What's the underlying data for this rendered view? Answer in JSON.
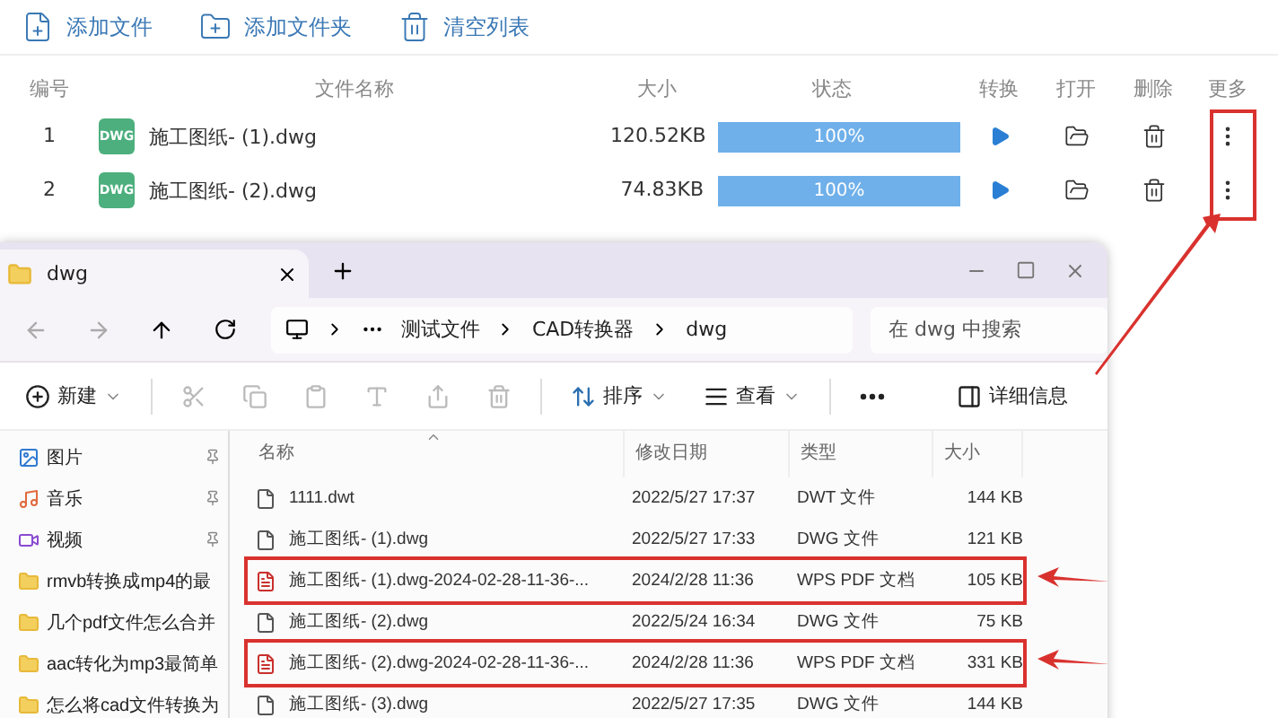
{
  "toolbar": [
    {
      "label": "添加文件",
      "kind": "file"
    },
    {
      "label": "添加文件夹",
      "kind": "folder"
    },
    {
      "label": "清空列表",
      "kind": "clear"
    }
  ],
  "table": {
    "columns": [
      "编号",
      "文件名称",
      "大小",
      "状态",
      "转换",
      "打开",
      "删除",
      "更多"
    ],
    "more_highlighted": true,
    "rows": [
      {
        "index": "1",
        "badge": "DWG",
        "name": "施工图纸- (1).dwg",
        "size": "120.52KB",
        "level": 1,
        "status": "100%"
      },
      {
        "index": "2",
        "badge": "DWG",
        "name": "施工图纸- (2).dwg",
        "size": "74.83KB",
        "level": 1,
        "status": "100%"
      }
    ]
  },
  "explorer": {
    "tab": {
      "title": "dwg"
    },
    "breadcrumb": [
      "测试文件",
      "CAD转换器",
      "dwg"
    ],
    "search": {
      "placeholder": "在 dwg 中搜索"
    },
    "commands": [
      {
        "label": "新建",
        "kind": "new"
      },
      {
        "label": "排序",
        "kind": "sort"
      },
      {
        "label": "查看",
        "kind": "view"
      }
    ],
    "details": "详细信息",
    "sidebar": [
      {
        "label": "图片",
        "kind": "pictures",
        "pinned": true
      },
      {
        "label": "音乐",
        "kind": "music",
        "pinned": true
      },
      {
        "label": "视频",
        "kind": "video",
        "pinned": true
      },
      {
        "label": "rmvb转换成mp4的最",
        "kind": "folder",
        "pinned": false
      },
      {
        "label": "几个pdf文件怎么合并",
        "kind": "folder",
        "pinned": false
      },
      {
        "label": "aac转化为mp3最简单",
        "kind": "folder",
        "pinned": false
      },
      {
        "label": "怎么将cad文件转换为",
        "kind": "folder",
        "pinned": false
      }
    ],
    "columns": [
      "名称",
      "修改日期",
      "类型",
      "大小"
    ],
    "files": [
      {
        "name": "1111.dwt",
        "date": "2022/5/27 17:37",
        "type": "DWT 文件",
        "size": "144 KB",
        "kind": "file",
        "highlighted": false
      },
      {
        "name": "施工图纸- (1).dwg",
        "date": "2022/5/27 17:33",
        "type": "DWG 文件",
        "size": "121 KB",
        "kind": "file",
        "highlighted": false
      },
      {
        "name": "施工图纸- (1).dwg-2024-02-28-11-36-...",
        "date": "2024/2/28 11:36",
        "type": "WPS PDF 文档",
        "size": "105 KB",
        "kind": "pdf",
        "highlighted": true
      },
      {
        "name": "施工图纸- (2).dwg",
        "date": "2022/5/24 16:34",
        "type": "DWG 文件",
        "size": "75 KB",
        "kind": "file",
        "highlighted": false
      },
      {
        "name": "施工图纸- (2).dwg-2024-02-28-11-36-...",
        "date": "2024/2/28 11:36",
        "type": "WPS PDF 文档",
        "size": "331 KB",
        "kind": "pdf",
        "highlighted": true
      },
      {
        "name": "施工图纸- (3).dwg",
        "date": "2022/5/27 17:35",
        "type": "DWG 文件",
        "size": "144 KB",
        "kind": "file",
        "highlighted": false
      }
    ]
  }
}
